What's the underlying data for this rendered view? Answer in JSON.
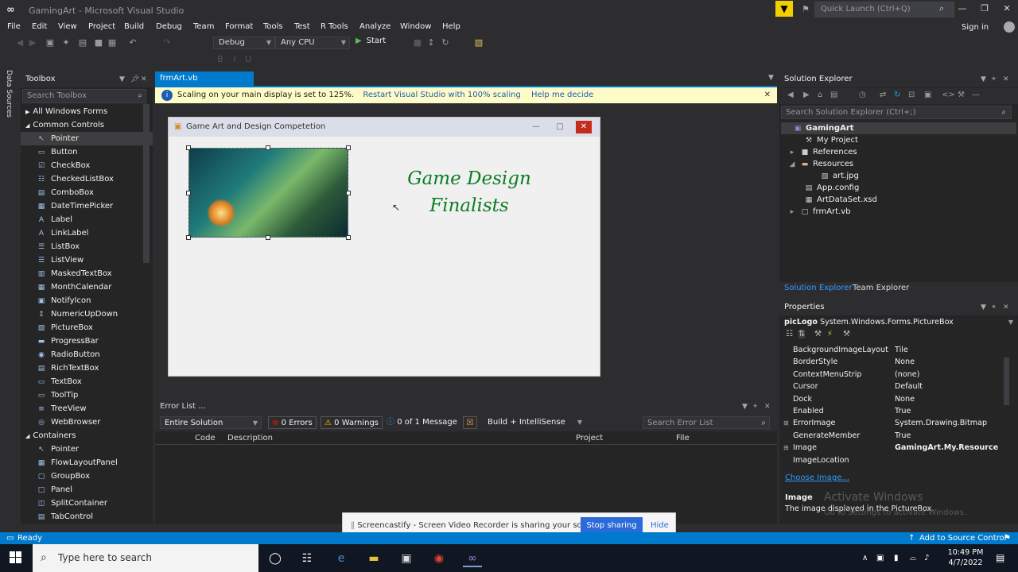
{
  "window": {
    "title": "GamingArt - Microsoft Visual Studio",
    "quick_launch_placeholder": "Quick Launch (Ctrl+Q)",
    "sign_in": "Sign in"
  },
  "menu": [
    "File",
    "Edit",
    "View",
    "Project",
    "Build",
    "Debug",
    "Team",
    "Format",
    "Tools",
    "Test",
    "R Tools",
    "Analyze",
    "Window",
    "Help"
  ],
  "toolbar": {
    "config": "Debug",
    "platform": "Any CPU",
    "start_label": "Start"
  },
  "side_strip": {
    "label": "Data Sources"
  },
  "toolbox": {
    "title": "Toolbox",
    "search_placeholder": "Search Toolbox",
    "groups": [
      {
        "label": "All Windows Forms",
        "expanded": false
      },
      {
        "label": "Common Controls",
        "expanded": true
      }
    ],
    "common_items": [
      "Pointer",
      "Button",
      "CheckBox",
      "CheckedListBox",
      "ComboBox",
      "DateTimePicker",
      "Label",
      "LinkLabel",
      "ListBox",
      "ListView",
      "MaskedTextBox",
      "MonthCalendar",
      "NotifyIcon",
      "NumericUpDown",
      "PictureBox",
      "ProgressBar",
      "RadioButton",
      "RichTextBox",
      "TextBox",
      "ToolTip",
      "TreeView",
      "WebBrowser"
    ],
    "containers_label": "Containers",
    "container_items": [
      "Pointer",
      "FlowLayoutPanel",
      "GroupBox",
      "Panel",
      "SplitContainer",
      "TabControl"
    ]
  },
  "document": {
    "tab_label": "frmArt.vb [Design]",
    "info_text": "Scaling on your main display is set to 125%.",
    "info_link1": "Restart Visual Studio with 100% scaling",
    "info_link2": "Help me decide",
    "form_title": "Game Art and Design Competetion",
    "heading_line1": "Game Design",
    "heading_line2": "Finalists"
  },
  "error_list": {
    "title": "Error List ...",
    "scope": "Entire Solution",
    "errors": "0 Errors",
    "warnings": "0 Warnings",
    "messages": "0 of 1 Message",
    "build_filter": "Build + IntelliSense",
    "search_placeholder": "Search Error List",
    "columns": [
      "Code",
      "Description",
      "Project",
      "File"
    ]
  },
  "solution_explorer": {
    "title": "Solution Explorer",
    "search_placeholder": "Search Solution Explorer (Ctrl+;)",
    "tree": [
      {
        "label": "GamingArt",
        "indent": 0,
        "selected": true
      },
      {
        "label": "My Project",
        "indent": 1
      },
      {
        "label": "References",
        "indent": 1
      },
      {
        "label": "Resources",
        "indent": 1
      },
      {
        "label": "art.jpg",
        "indent": 2
      },
      {
        "label": "App.config",
        "indent": 1
      },
      {
        "label": "ArtDataSet.xsd",
        "indent": 1
      },
      {
        "label": "frmArt.vb",
        "indent": 1
      }
    ],
    "tab1": "Solution Explorer",
    "tab2": "Team Explorer"
  },
  "properties": {
    "title": "Properties",
    "object_name": "picLogo",
    "object_type": "System.Windows.Forms.PictureBox",
    "rows": [
      {
        "name": "BackgroundImageLayout",
        "value": "Tile"
      },
      {
        "name": "BorderStyle",
        "value": "None"
      },
      {
        "name": "ContextMenuStrip",
        "value": "(none)"
      },
      {
        "name": "Cursor",
        "value": "Default"
      },
      {
        "name": "Dock",
        "value": "None"
      },
      {
        "name": "Enabled",
        "value": "True"
      },
      {
        "name": "ErrorImage",
        "value": "System.Drawing.Bitmap"
      },
      {
        "name": "GenerateMember",
        "value": "True"
      },
      {
        "name": "Image",
        "value": "GamingArt.My.Resource"
      },
      {
        "name": "ImageLocation",
        "value": ""
      }
    ],
    "choose_image_link": "Choose Image...",
    "desc_title": "Image",
    "desc_text": "The image displayed in the PictureBox."
  },
  "status": {
    "text": "Ready",
    "right": "Add to Source Control"
  },
  "screen_share": {
    "text": "Screencastify - Screen Video Recorder is sharing your screen.",
    "stop_label": "Stop sharing",
    "hide_label": "Hide"
  },
  "activation": {
    "line1": "Activate Windows",
    "line2": "Go to Settings to activate Windows."
  },
  "taskbar": {
    "search_placeholder": "Type here to search",
    "time": "10:49 PM",
    "date": "4/7/2022"
  }
}
